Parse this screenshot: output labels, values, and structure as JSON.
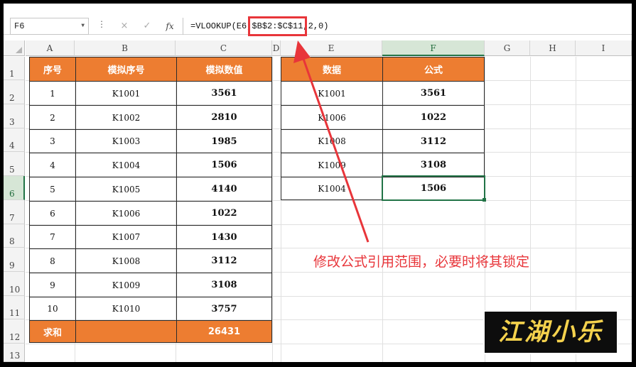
{
  "formula_bar": {
    "name_box": "F6",
    "separator": "⋮",
    "cancel_icon": "×",
    "enter_icon": "✓",
    "fx_label": "fx",
    "formula": "=VLOOKUP(E6,$B$2:$C$11,2,0)"
  },
  "columns": [
    "A",
    "B",
    "C",
    "D",
    "E",
    "F",
    "G",
    "H",
    "I"
  ],
  "rows": [
    "1",
    "2",
    "3",
    "4",
    "5",
    "6",
    "7",
    "8",
    "9",
    "10",
    "11",
    "12",
    "13"
  ],
  "left_table": {
    "headers": [
      "序号",
      "模拟序号",
      "模拟数值"
    ],
    "rows": [
      [
        "1",
        "K1001",
        "3561"
      ],
      [
        "2",
        "K1002",
        "2810"
      ],
      [
        "3",
        "K1003",
        "1985"
      ],
      [
        "4",
        "K1004",
        "1506"
      ],
      [
        "5",
        "K1005",
        "4140"
      ],
      [
        "6",
        "K1006",
        "1022"
      ],
      [
        "7",
        "K1007",
        "1430"
      ],
      [
        "8",
        "K1008",
        "3112"
      ],
      [
        "9",
        "K1009",
        "3108"
      ],
      [
        "10",
        "K1010",
        "3757"
      ]
    ],
    "total_label": "求和",
    "total_value": "26431"
  },
  "right_table": {
    "headers": [
      "数据",
      "公式"
    ],
    "rows": [
      [
        "K1001",
        "3561"
      ],
      [
        "K1006",
        "1022"
      ],
      [
        "K1008",
        "3112"
      ],
      [
        "K1009",
        "3108"
      ],
      [
        "K1004",
        "1506"
      ]
    ]
  },
  "annotation": "修改公式引用范围，必要时将其锁定",
  "logo_text": "江湖小乐",
  "colors": {
    "accent": "#ed7d31",
    "highlight": "#e8353a",
    "selection": "#217346"
  }
}
